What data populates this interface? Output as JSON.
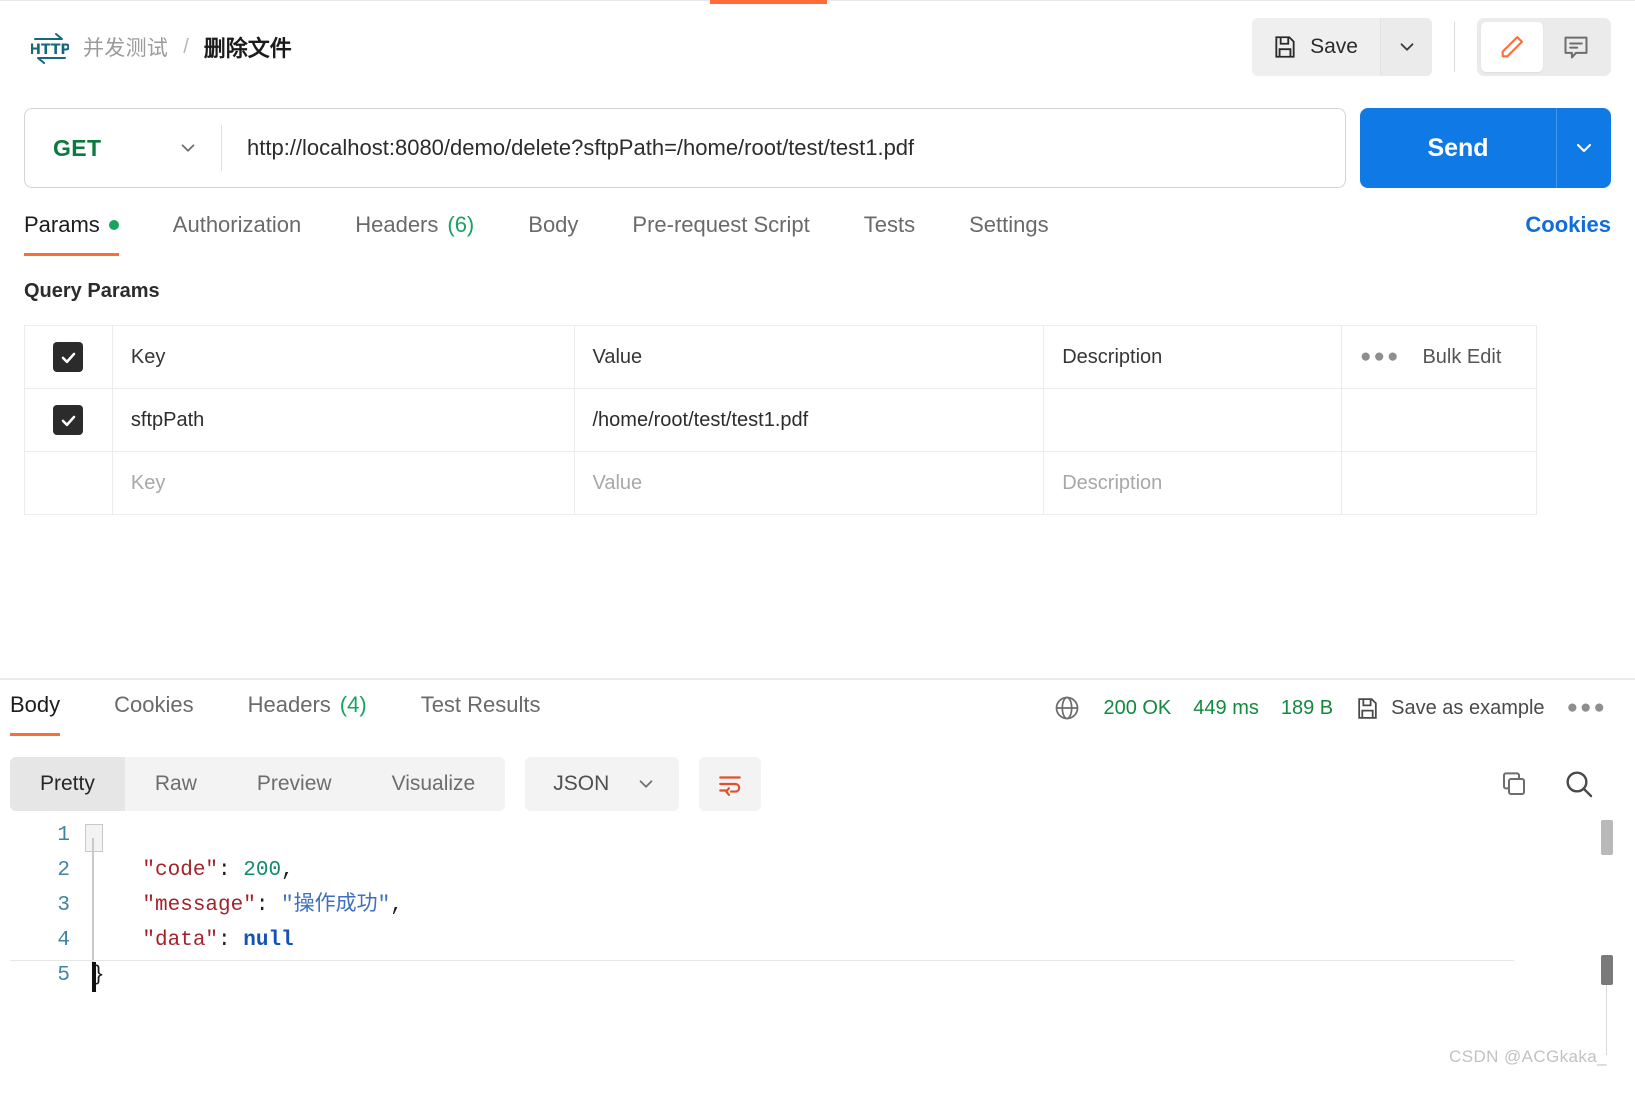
{
  "header": {
    "protocol_icon": "http-icon",
    "breadcrumb_parent": "并发测试",
    "breadcrumb_separator": "/",
    "breadcrumb_current": "删除文件",
    "save_label": "Save",
    "save_icon": "floppy-disk-icon",
    "save_caret_icon": "chevron-down-icon",
    "edit_icon": "pencil-icon",
    "comment_icon": "comment-icon"
  },
  "request": {
    "method": "GET",
    "method_caret_icon": "chevron-down-icon",
    "url": "http://localhost:8080/demo/delete?sftpPath=/home/root/test/test1.pdf",
    "send_label": "Send",
    "send_caret_icon": "chevron-down-icon",
    "tabs": [
      {
        "label": "Params",
        "badge": "",
        "dot": true,
        "active": true
      },
      {
        "label": "Authorization",
        "badge": "",
        "dot": false,
        "active": false
      },
      {
        "label": "Headers",
        "badge": "(6)",
        "dot": false,
        "active": false
      },
      {
        "label": "Body",
        "badge": "",
        "dot": false,
        "active": false
      },
      {
        "label": "Pre-request Script",
        "badge": "",
        "dot": false,
        "active": false
      },
      {
        "label": "Tests",
        "badge": "",
        "dot": false,
        "active": false
      },
      {
        "label": "Settings",
        "badge": "",
        "dot": false,
        "active": false
      }
    ],
    "cookies_link": "Cookies"
  },
  "query_params": {
    "section_title": "Query Params",
    "columns": [
      "Key",
      "Value",
      "Description"
    ],
    "bulk_edit_label": "Bulk Edit",
    "more_icon": "ellipsis-icon",
    "rows": [
      {
        "checked": true,
        "key": "sftpPath",
        "value": "/home/root/test/test1.pdf",
        "description": ""
      }
    ],
    "placeholder_row": {
      "key": "Key",
      "value": "Value",
      "description": "Description"
    }
  },
  "response": {
    "tabs": [
      {
        "label": "Body",
        "badge": "",
        "active": true
      },
      {
        "label": "Cookies",
        "badge": "",
        "active": false
      },
      {
        "label": "Headers",
        "badge": "(4)",
        "active": false
      },
      {
        "label": "Test Results",
        "badge": "",
        "active": false
      }
    ],
    "globe_icon": "globe-icon",
    "status": "200 OK",
    "time": "449 ms",
    "size": "189 B",
    "save_example_label": "Save as example",
    "save_example_icon": "floppy-disk-icon",
    "more_icon": "ellipsis-icon",
    "view_modes": [
      "Pretty",
      "Raw",
      "Preview",
      "Visualize"
    ],
    "active_view_mode": "Pretty",
    "format": "JSON",
    "format_caret_icon": "chevron-down-icon",
    "wrap_icon": "wrap-text-icon",
    "copy_icon": "copy-icon",
    "search_icon": "search-icon",
    "body_lines": [
      {
        "n": "1",
        "tokens": [
          {
            "t": "{",
            "c": "jpunc"
          }
        ]
      },
      {
        "n": "2",
        "tokens": [
          {
            "t": "    \"code\"",
            "c": "jkey"
          },
          {
            "t": ": ",
            "c": "jpunc"
          },
          {
            "t": "200",
            "c": "jnum"
          },
          {
            "t": ",",
            "c": "jpunc"
          }
        ]
      },
      {
        "n": "3",
        "tokens": [
          {
            "t": "    \"message\"",
            "c": "jkey"
          },
          {
            "t": ": ",
            "c": "jpunc"
          },
          {
            "t": "\"操作成功\"",
            "c": "jstr"
          },
          {
            "t": ",",
            "c": "jpunc"
          }
        ]
      },
      {
        "n": "4",
        "tokens": [
          {
            "t": "    \"data\"",
            "c": "jkey"
          },
          {
            "t": ": ",
            "c": "jpunc"
          },
          {
            "t": "null",
            "c": "jnull"
          }
        ]
      },
      {
        "n": "5",
        "tokens": [
          {
            "t": "}",
            "c": "jpunc"
          }
        ]
      }
    ]
  },
  "watermark": "CSDN @ACGkaka_",
  "colors": {
    "accent": "#ff6c37",
    "send": "#0f7ae5",
    "method_green": "#0c7a3e",
    "status_green": "#128a3e",
    "link_blue": "#0f6fd6"
  }
}
